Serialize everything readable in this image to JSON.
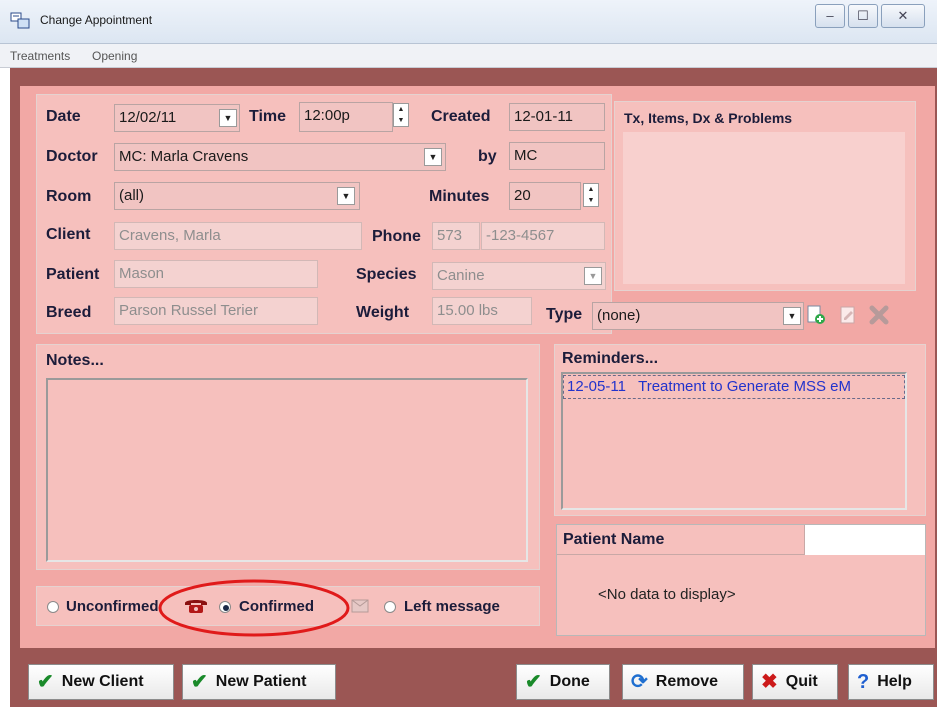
{
  "window": {
    "title": "Change Appointment",
    "minimize": "–",
    "maximize": "☐",
    "close": "✕"
  },
  "menu": [
    "Treatments",
    "Opening"
  ],
  "form": {
    "date": {
      "label": "Date",
      "value": "12/02/11"
    },
    "time": {
      "label": "Time",
      "value": "12:00p"
    },
    "created": {
      "label": "Created",
      "value": "12-01-11"
    },
    "doctor": {
      "label": "Doctor",
      "value": "MC: Marla Cravens"
    },
    "by": {
      "label": "by",
      "value": "MC"
    },
    "room": {
      "label": "Room",
      "value": "(all)"
    },
    "minutes": {
      "label": "Minutes",
      "value": "20"
    },
    "client": {
      "label": "Client",
      "value": "Cravens, Marla"
    },
    "phone": {
      "label": "Phone",
      "area": "573",
      "number": "-123-4567"
    },
    "patient": {
      "label": "Patient",
      "value": "Mason"
    },
    "species": {
      "label": "Species",
      "value": "Canine"
    },
    "breed": {
      "label": "Breed",
      "value": "Parson Russel Terier"
    },
    "weight": {
      "label": "Weight",
      "value": "15.00 lbs"
    },
    "type": {
      "label": "Type",
      "value": "(none)"
    }
  },
  "tx_panel": {
    "title": "Tx, Items, Dx & Problems"
  },
  "notes": {
    "title": "Notes...",
    "value": ""
  },
  "reminders": {
    "title": "Reminders...",
    "items": [
      {
        "date": "12-05-11",
        "text": "Treatment to Generate MSS eM"
      }
    ]
  },
  "patient_name_panel": {
    "header": "Patient Name",
    "empty": "<No data to display>"
  },
  "status": {
    "options": [
      "Unconfirmed",
      "Confirmed",
      "Left message"
    ],
    "selected": "Confirmed"
  },
  "buttons": {
    "new_client": "New Client",
    "new_patient": "New Patient",
    "done": "Done",
    "remove": "Remove",
    "quit": "Quit",
    "help": "Help"
  },
  "colors": {
    "form_background": "#f2a8a5",
    "frame_background": "#9b5654",
    "highlight_circle": "#e01a1a",
    "reminder_text": "#2233cc"
  }
}
